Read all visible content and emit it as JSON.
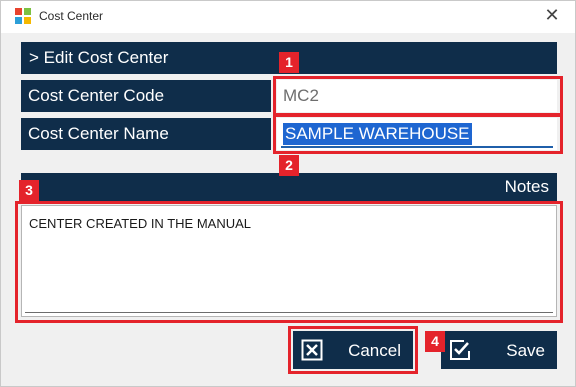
{
  "window": {
    "title": "Cost Center",
    "close_glyph": "✕",
    "icon": "app-logo-icon"
  },
  "form": {
    "header": "> Edit Cost Center",
    "code_label": "Cost Center Code",
    "code_value": "MC2",
    "name_label": "Cost Center Name",
    "name_value": "SAMPLE WAREHOUSE",
    "notes_label": "Notes",
    "notes_value": "CENTER CREATED IN THE MANUAL"
  },
  "buttons": {
    "cancel_label": "Cancel",
    "cancel_icon": "close-box-icon",
    "save_label": "Save",
    "save_icon": "check-box-icon"
  },
  "callouts": [
    "1",
    "2",
    "3",
    "4"
  ],
  "colors": {
    "accent_navy": "#0f2d4a",
    "callout_red": "#e4232b",
    "selection_blue": "#1e66d1"
  }
}
